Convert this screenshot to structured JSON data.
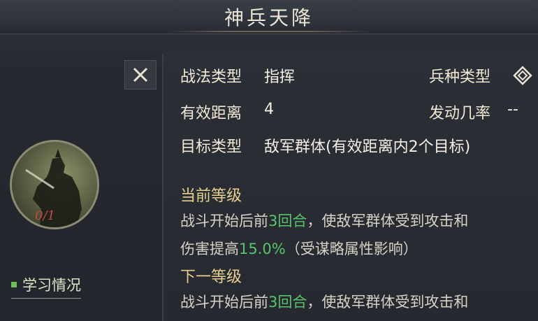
{
  "title": "神兵天降",
  "close_label": "✕",
  "avatar_count": "0/1",
  "study_link": "学习情况",
  "info": {
    "tactic_type_label": "战法类型",
    "tactic_type_value": "指挥",
    "unit_type_label": "兵种类型",
    "range_label": "有效距离",
    "range_value": "4",
    "trigger_rate_label": "发动几率",
    "trigger_rate_value": "--",
    "target_type_label": "目标类型",
    "target_type_value": "敌军群体(有效距离内2个目标)"
  },
  "current_level": {
    "title": "当前等级",
    "line1_pre": "战斗开始后前",
    "line1_num": "3",
    "line1_mid": "回合",
    "line1_post": "，使敌军群体受到攻击和",
    "line2_pre": "伤害提高",
    "line2_num": "15.0%",
    "line2_post": "（受谋略属性影响）"
  },
  "next_level": {
    "title": "下一等级",
    "line1_pre": "战斗开始后前",
    "line1_num": "3",
    "line1_mid": "回合",
    "line1_post": "，使敌军群体受到攻击和"
  }
}
